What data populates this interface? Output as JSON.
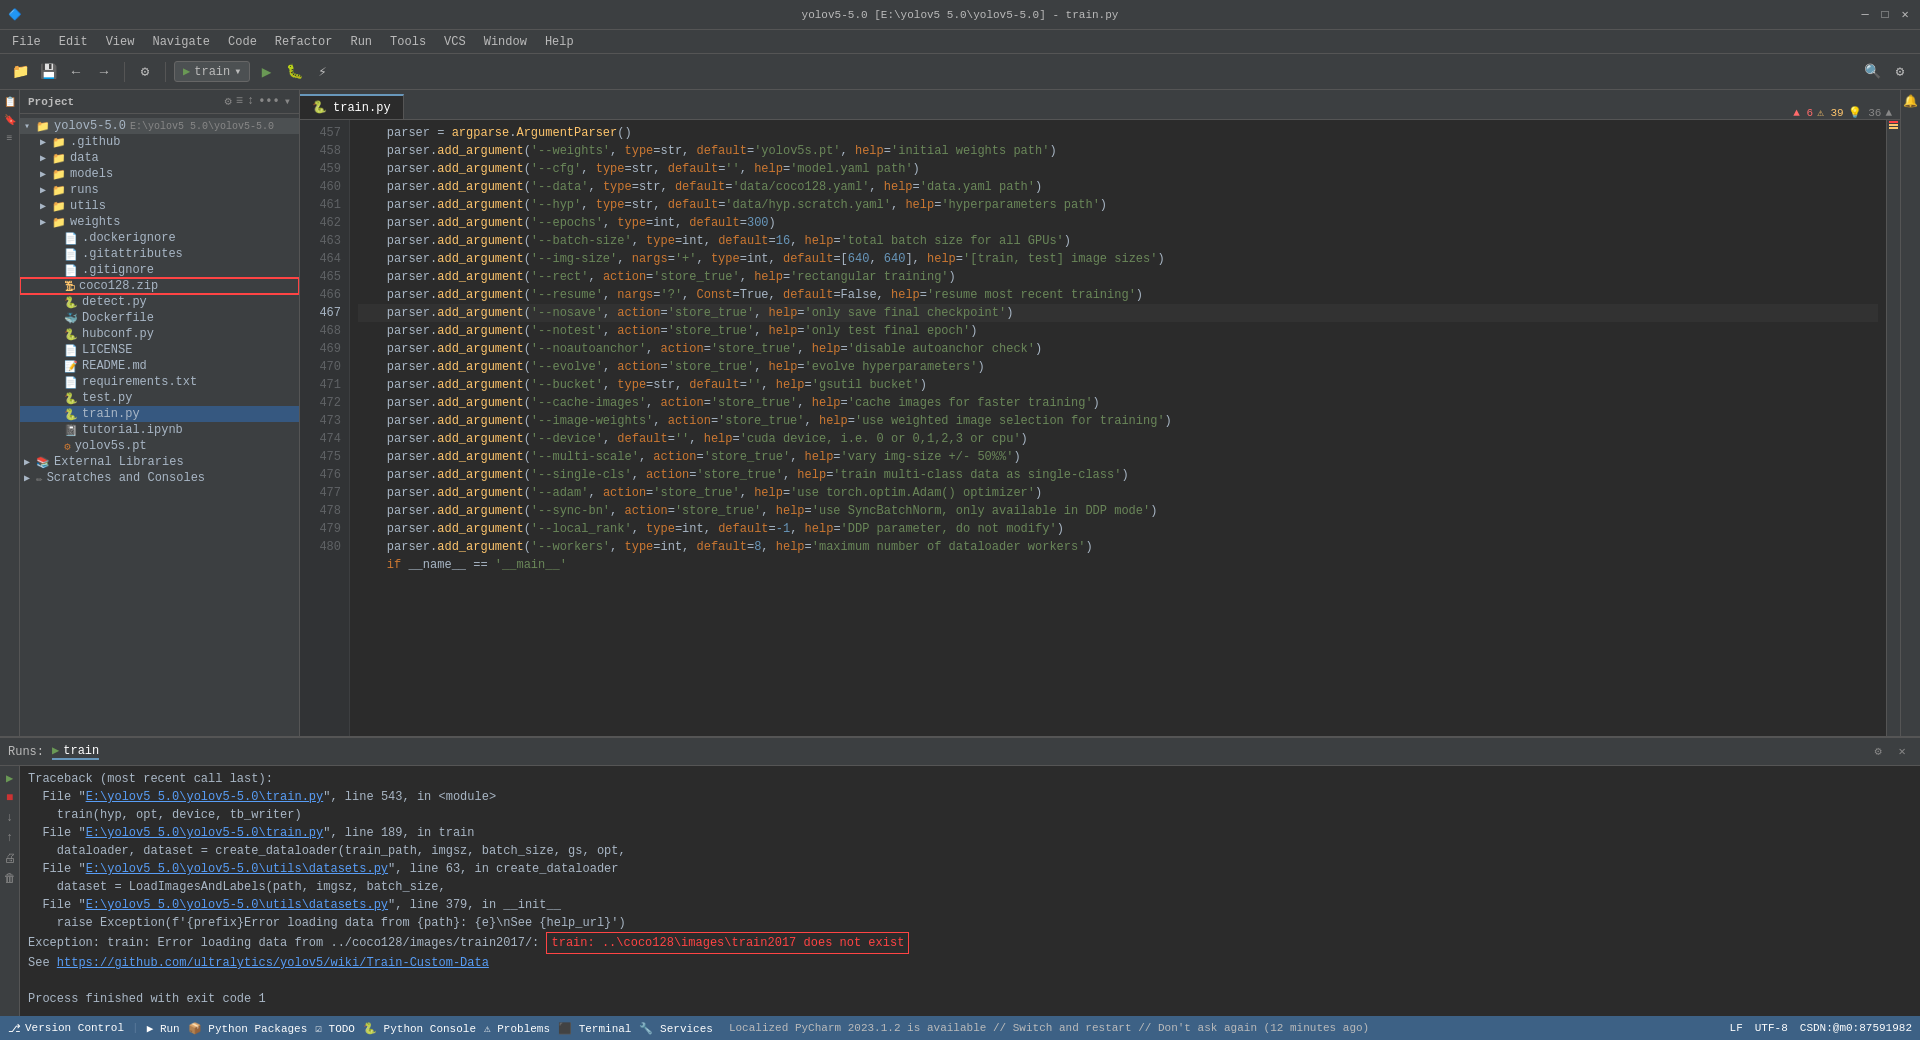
{
  "window": {
    "title": "yolov5-5.0 [E:\\yolov5 5.0\\yolov5-5.0] - train.py",
    "minimize": "─",
    "maximize": "□",
    "close": "✕"
  },
  "menu": {
    "items": [
      "File",
      "Edit",
      "View",
      "Navigate",
      "Code",
      "Refactor",
      "Run",
      "Tools",
      "VCS",
      "Window",
      "Help"
    ]
  },
  "toolbar": {
    "run_config": "train",
    "run_label": "▶",
    "debug_label": "🐛",
    "coverage_label": "⚡"
  },
  "project_panel": {
    "title": "Project",
    "root": "yolov5-5.0",
    "root_path": "E:\\yolov5 5.0\\yolov5-5.0"
  },
  "file_tree": [
    {
      "name": "yolov5-5.0",
      "type": "root",
      "indent": 0,
      "expanded": true,
      "path": "E:\\yolov5 5.0\\yolov5-5.0"
    },
    {
      "name": ".github",
      "type": "folder",
      "indent": 1,
      "expanded": false
    },
    {
      "name": "data",
      "type": "folder",
      "indent": 1,
      "expanded": false
    },
    {
      "name": "models",
      "type": "folder",
      "indent": 1,
      "expanded": false
    },
    {
      "name": "runs",
      "type": "folder",
      "indent": 1,
      "expanded": false
    },
    {
      "name": "utils",
      "type": "folder",
      "indent": 1,
      "expanded": false
    },
    {
      "name": "weights",
      "type": "folder",
      "indent": 1,
      "expanded": false
    },
    {
      "name": ".dockerignore",
      "type": "file",
      "indent": 1,
      "icon": "text"
    },
    {
      "name": ".gitattributes",
      "type": "file",
      "indent": 1,
      "icon": "text"
    },
    {
      "name": ".gitignore",
      "type": "file",
      "indent": 1,
      "icon": "git"
    },
    {
      "name": "coco128.zip",
      "type": "file",
      "indent": 1,
      "icon": "zip",
      "highlighted": true
    },
    {
      "name": "detect.py",
      "type": "file",
      "indent": 1,
      "icon": "python"
    },
    {
      "name": "Dockerfile",
      "type": "file",
      "indent": 1,
      "icon": "docker"
    },
    {
      "name": "hubconf.py",
      "type": "file",
      "indent": 1,
      "icon": "python"
    },
    {
      "name": "LICENSE",
      "type": "file",
      "indent": 1,
      "icon": "text"
    },
    {
      "name": "README.md",
      "type": "file",
      "indent": 1,
      "icon": "md"
    },
    {
      "name": "requirements.txt",
      "type": "file",
      "indent": 1,
      "icon": "text"
    },
    {
      "name": "test.py",
      "type": "file",
      "indent": 1,
      "icon": "python"
    },
    {
      "name": "train.py",
      "type": "file",
      "indent": 1,
      "icon": "python",
      "selected": true
    },
    {
      "name": "tutorial.ipynb",
      "type": "file",
      "indent": 1,
      "icon": "notebook"
    },
    {
      "name": "yolov5s.pt",
      "type": "file",
      "indent": 1,
      "icon": "model"
    }
  ],
  "external_libraries": "External Libraries",
  "scratches": "Scratches and Consoles",
  "editor": {
    "tab_name": "train.py",
    "breadcrumb": "train.py"
  },
  "code_lines": [
    {
      "num": 457,
      "text": "    parser = argparse.ArgumentParser()"
    },
    {
      "num": 458,
      "text": "    parser.add_argument('--weights', type=str, default='yolov5s.pt', help='initial weights path')"
    },
    {
      "num": 459,
      "text": "    parser.add_argument('--cfg', type=str, default='', help='model.yaml path')"
    },
    {
      "num": 460,
      "text": "    parser.add_argument('--data', type=str, default='data/coco128.yaml', help='data.yaml path')"
    },
    {
      "num": 461,
      "text": "    parser.add_argument('--hyp', type=str, default='data/hyp.scratch.yaml', help='hyperparameters path')"
    },
    {
      "num": 462,
      "text": "    parser.add_argument('--epochs', type=int, default=300)"
    },
    {
      "num": 463,
      "text": "    parser.add_argument('--batch-size', type=int, default=16, help='total batch size for all GPUs')"
    },
    {
      "num": 464,
      "text": "    parser.add_argument('--img-size', nargs='+', type=int, default=[640, 640], help='[train, test] image sizes')"
    },
    {
      "num": 465,
      "text": "    parser.add_argument('--rect', action='store_true', help='rectangular training')"
    },
    {
      "num": 466,
      "text": "    parser.add_argument('--resume', nargs='?', Const=True, default=False, help='resume most recent training')"
    },
    {
      "num": 467,
      "text": "    parser.add_argument('--nosave', action='store_true', help='only save final checkpoint')",
      "current": true
    },
    {
      "num": 468,
      "text": "    parser.add_argument('--notest', action='store_true', help='only test final epoch')"
    },
    {
      "num": 469,
      "text": "    parser.add_argument('--noautoanchor', action='store_true', help='disable autoanchor check')"
    },
    {
      "num": 470,
      "text": "    parser.add_argument('--evolve', action='store_true', help='evolve hyperparameters')"
    },
    {
      "num": 471,
      "text": "    parser.add_argument('--bucket', type=str, default='', help='gsutil bucket')"
    },
    {
      "num": 472,
      "text": "    parser.add_argument('--cache-images', action='store_true', help='cache images for faster training')"
    },
    {
      "num": 473,
      "text": "    parser.add_argument('--image-weights', action='store_true', help='use weighted image selection for training')"
    },
    {
      "num": 474,
      "text": "    parser.add_argument('--device', default='', help='cuda device, i.e. 0 or 0,1,2,3 or cpu')"
    },
    {
      "num": 475,
      "text": "    parser.add_argument('--multi-scale', action='store_true', help='vary img-size +/- 50%%')"
    },
    {
      "num": 476,
      "text": "    parser.add_argument('--single-cls', action='store_true', help='train multi-class data as single-class')"
    },
    {
      "num": 477,
      "text": "    parser.add_argument('--adam', action='store_true', help='use torch.optim.Adam() optimizer')"
    },
    {
      "num": 478,
      "text": "    parser.add_argument('--sync-bn', action='store_true', help='use SyncBatchNorm, only available in DDP mode')"
    },
    {
      "num": 479,
      "text": "    parser.add_argument('--local_rank', type=int, default=-1, help='DDP parameter, do not modify')"
    },
    {
      "num": 480,
      "text": "    parser.add_argument('--workers', type=int, default=8, help='maximum number of dataloader workers')"
    }
  ],
  "bottom_line": "    if __name__ == '__main__':",
  "run_panel": {
    "tab": "train",
    "output_lines": [
      {
        "text": "Traceback (most recent call last):",
        "type": "normal"
      },
      {
        "text": "  File \"E:\\yolov5 5.0\\yolov5-5.0\\train.py\", line 543, in <module>",
        "type": "link"
      },
      {
        "text": "    train(hyp, opt, device, tb_writer)",
        "type": "normal"
      },
      {
        "text": "  File \"E:\\yolov5 5.0\\yolov5-5.0\\train.py\", line 189, in train",
        "type": "link"
      },
      {
        "text": "    dataloader, dataset = create_dataloader(train_path, imgsz, batch_size, gs, opt,",
        "type": "normal"
      },
      {
        "text": "  File \"E:\\yolov5 5.0\\yolov5-5.0\\utils\\datasets.py\", line 63, in create_dataloader",
        "type": "link"
      },
      {
        "text": "    dataset = LoadImagesAndLabels(path, imgsz, batch_size,",
        "type": "normal"
      },
      {
        "text": "  File \"E:\\yolov5 5.0\\yolov5-5.0\\utils\\datasets.py\", line 379, in __init__",
        "type": "link"
      },
      {
        "text": "    raise Exception(f'{prefix}Error loading data from {path}: {e}\\nSee {help_url}')",
        "type": "normal"
      },
      {
        "text": "Exception: train: Error loading data from ../coco128/images/train2017/: ",
        "type": "normal",
        "error_box": "train: ..\\coco128\\images\\train2017 does not exist"
      },
      {
        "text": "See https://github.com/ultralytics/yolov5/wiki/Train-Custom-Data",
        "type": "link_line"
      },
      {
        "text": "",
        "type": "normal"
      },
      {
        "text": "Process finished with exit code 1",
        "type": "normal"
      }
    ]
  },
  "status_bar": {
    "version_control": "Version Control",
    "run": "Run",
    "python_packages": "Python Packages",
    "todo": "TODO",
    "python_console": "Python Console",
    "problems": "Problems",
    "terminal": "Terminal",
    "services": "Services",
    "notification": "Localized PyCharm 2023.1.2 is available // Switch and restart // Don't ask again (12 minutes ago)",
    "line_ending": "LF",
    "encoding": "UTF-8",
    "position": "CSDN:@m0:87591982"
  },
  "error_counts": {
    "errors": "6",
    "warnings": "39",
    "hints": "36"
  }
}
